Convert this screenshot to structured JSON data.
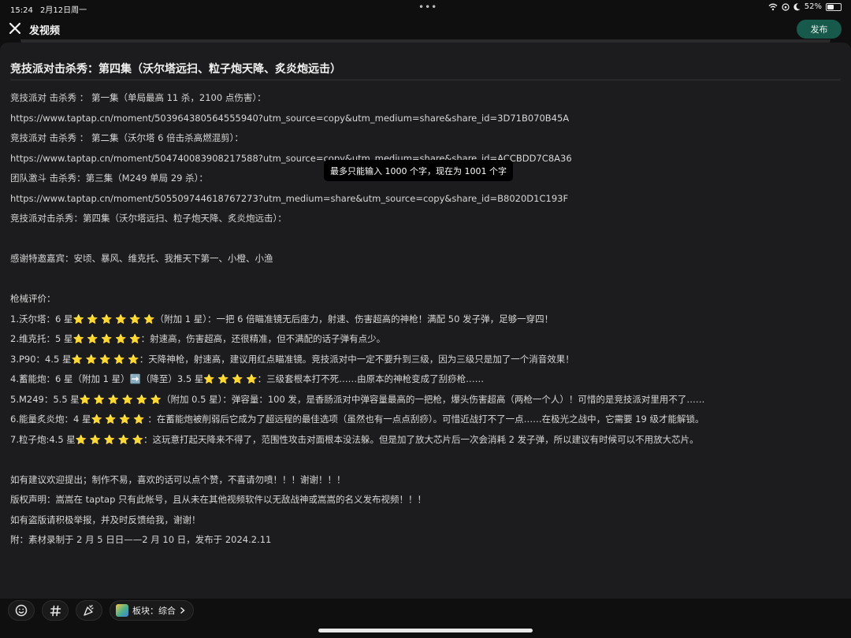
{
  "status_bar": {
    "time": "15:24",
    "date": "2月12日周一",
    "battery": "52%",
    "battery_level": 0.52
  },
  "header": {
    "title": "发视频",
    "publish_label": "发布"
  },
  "post": {
    "title": "竞技派对击杀秀：第四集（沃尔塔远扫、粒子炮天降、炙炎炮远击）",
    "lines": [
      "竞技派对 击杀秀 ： 第一集（单局最高 11 杀，2100 点伤害）：",
      "https://www.taptap.cn/moment/503964380564555940?utm_source=copy&utm_medium=share&share_id=3D71B070B45A",
      "竞技派对 击杀秀 ： 第二集（沃尔塔 6 倍击杀高燃混剪）：",
      "https://www.taptap.cn/moment/504740083908217588?utm_source=copy&utm_medium=share&share_id=ACCBDD7C8A36",
      "团队激斗 击杀秀：第三集（M249 单局 29 杀）：",
      "https://www.taptap.cn/moment/505509744618767273?utm_medium=share&utm_source=copy&share_id=B8020D1C193F",
      "竞技派对击杀秀：第四集（沃尔塔远扫、粒子炮天降、炙炎炮远击）：",
      "",
      "感谢特邀嘉宾：安顷、暴风、维克托、我推天下第一、小橙、小渔",
      "",
      "枪械评价：",
      "1.沃尔塔：6 星⭐ ⭐ ⭐ ⭐ ⭐ ⭐（附加 1 星）：一把 6 倍瞄准镜无后座力，射速、伤害超高的神枪！满配 50 发子弹，足够一穿四！",
      "2.维克托：5 星⭐ ⭐ ⭐ ⭐ ⭐：射速高，伤害超高，还很精准，但不满配的话子弹有点少。",
      "3.P90：4.5 星⭐ ⭐ ⭐ ⭐ ⭐：天降神枪，射速高，建议用红点瞄准镜。竞技派对中一定不要升到三级，因为三级只是加了一个消音效果！",
      "4.蓄能炮：6 星（附加 1 星）➡️（降至）3.5 星⭐ ⭐ ⭐ ⭐：三级套根本打不死……由原本的神枪变成了刮痧枪……",
      "5.M249：5.5 星⭐ ⭐ ⭐ ⭐ ⭐ ⭐（附加 0.5 星）：弹容量：100 发，是香肠派对中弹容量最高的一把枪，爆头伤害超高（两枪一个人）！可惜的是竞技派对里用不了……",
      "6.能量炙炎炮：4 星⭐ ⭐ ⭐ ⭐ ：在蓄能炮被削弱后它成为了超远程的最佳选项（虽然也有一点点刮痧）。可惜近战打不了一点……在极光之战中，它需要 19 级才能解锁。",
      "7.粒子炮:4.5 星⭐ ⭐ ⭐ ⭐ ⭐：这玩意打起天降来不得了，范围性攻击对面根本没法躲。但是加了放大芯片后一次会消耗 2 发子弹，所以建议有时候可以不用放大芯片。",
      "",
      "如有建议欢迎提出；制作不易，喜欢的话可以点个赞，不喜请勿喷！！！谢谢！！！",
      "版权声明：嵩嵩在 taptap 只有此帐号，且从未在其他视频软件以无敌战神或嵩嵩的名义发布视频！！！",
      "如有盗版请积极举报，并及时反馈给我，谢谢！",
      "附：素材录制于 2 月 5 日日——2 月 10 日，发布于 2024.2.11"
    ]
  },
  "toast": "最多只能输入 1000 个字，现在为 1001 个字",
  "toolbar": {
    "emoji_icon": "emoji-icon",
    "hashtag_icon": "hashtag-icon",
    "activity_icon": "party-icon",
    "category_label": "板块：综合"
  }
}
